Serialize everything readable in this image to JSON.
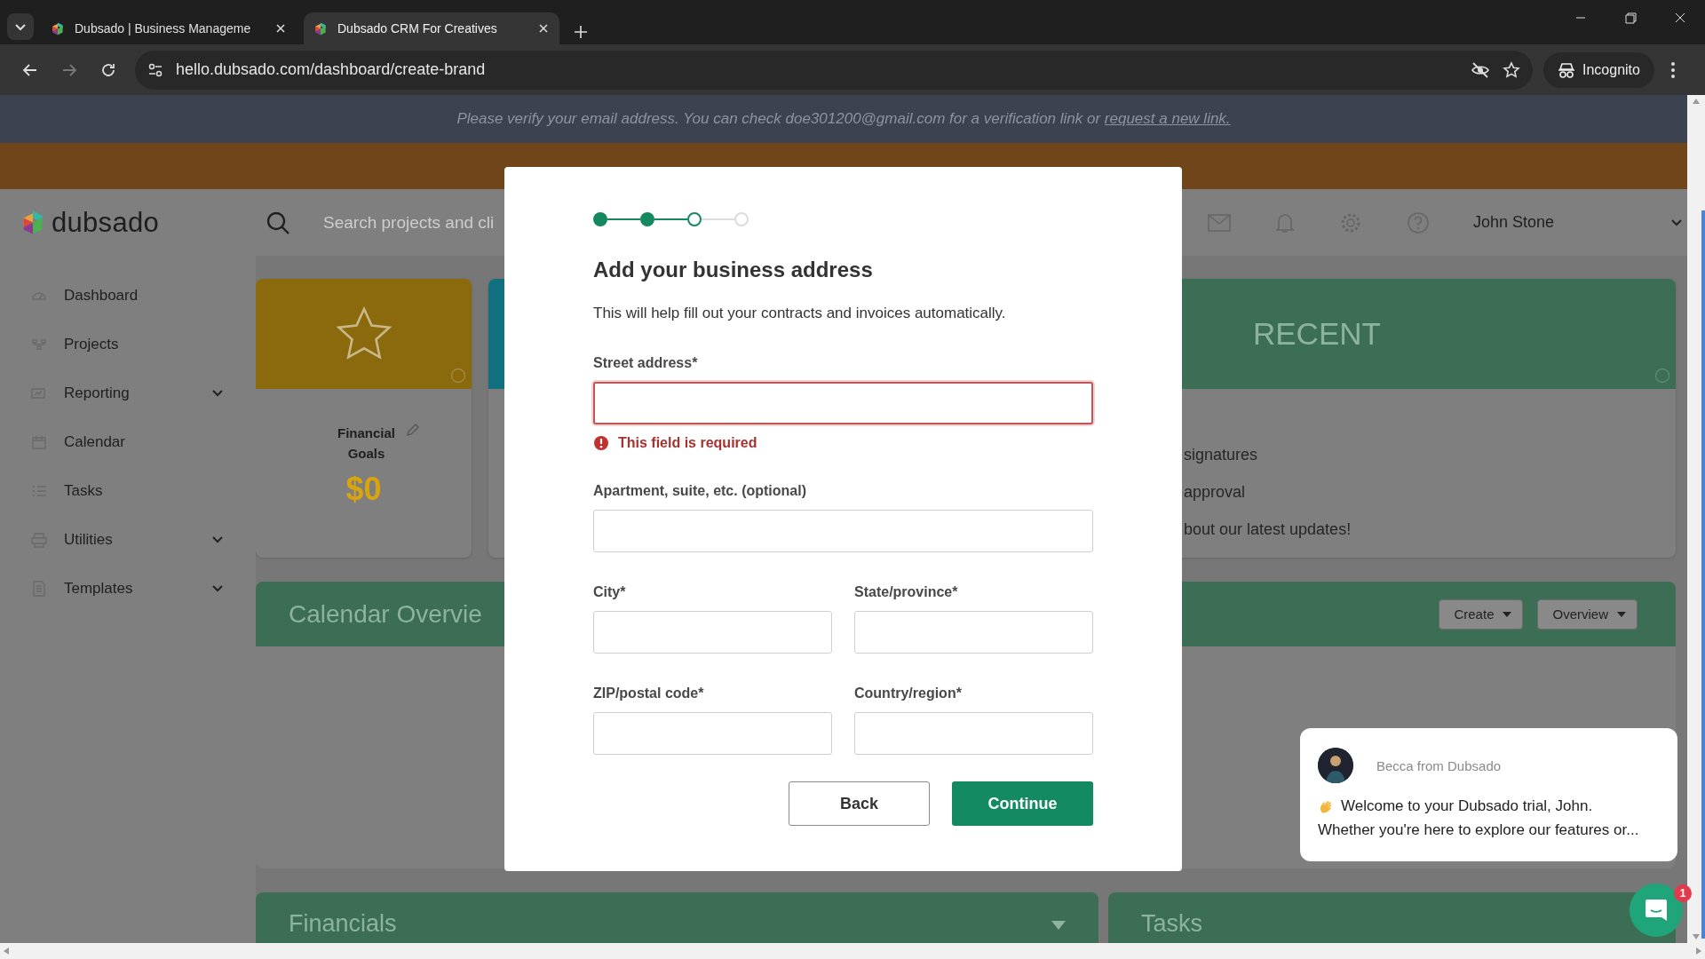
{
  "browser": {
    "tabs": [
      {
        "title": "Dubsado | Business Manageme",
        "selected": false
      },
      {
        "title": "Dubsado CRM For Creatives",
        "selected": true
      }
    ],
    "address": "hello.dubsado.com/dashboard/create-brand",
    "profile": "Incognito"
  },
  "verify_banner": {
    "text": "Please verify your email address. You can check doe301200@gmail.com for a verification link or ",
    "link": "request a new link."
  },
  "header": {
    "logo": "dubsado",
    "search_placeholder": "Search projects and cli",
    "user": "John Stone"
  },
  "sidebar": {
    "items": [
      {
        "label": "Dashboard",
        "has_submenu": false
      },
      {
        "label": "Projects",
        "has_submenu": false
      },
      {
        "label": "Reporting",
        "has_submenu": true
      },
      {
        "label": "Calendar",
        "has_submenu": false
      },
      {
        "label": "Tasks",
        "has_submenu": false
      },
      {
        "label": "Utilities",
        "has_submenu": true
      },
      {
        "label": "Templates",
        "has_submenu": true
      }
    ]
  },
  "goal_card": {
    "title": "Financial Goals",
    "value": "$0"
  },
  "recent_card": {
    "title": "RECENT",
    "items": [
      "signatures",
      "approval",
      "bout our latest updates!"
    ]
  },
  "calendar": {
    "title": "Calendar Overvie",
    "buttons": [
      "Create",
      "Overview"
    ]
  },
  "bottom_panels": [
    "Financials",
    "Tasks"
  ],
  "modal": {
    "steps": [
      {
        "completed": true,
        "current": false
      },
      {
        "completed": true,
        "current": false
      },
      {
        "completed": false,
        "current": true
      },
      {
        "completed": false,
        "current": false
      }
    ],
    "title": "Add your business address",
    "subtitle": "This will help fill out your contracts and invoices automatically.",
    "rows": [
      [
        {
          "label": "Street address*",
          "invalid": true,
          "error": "This field is required"
        }
      ],
      [
        {
          "label": "Apartment, suite, etc. (optional)",
          "invalid": false
        }
      ],
      [
        {
          "label": "City*",
          "invalid": false
        },
        {
          "label": "State/province*",
          "invalid": false
        }
      ],
      [
        {
          "label": "ZIP/postal code*",
          "invalid": false
        },
        {
          "label": "Country/region*",
          "invalid": false
        }
      ]
    ],
    "back": "Back",
    "continue": "Continue"
  },
  "chat": {
    "sender": "Becca from Dubsado",
    "lines": [
      "Welcome to your Dubsado trial, John.",
      "Whether you're here to explore our features or..."
    ],
    "badge": "1"
  }
}
